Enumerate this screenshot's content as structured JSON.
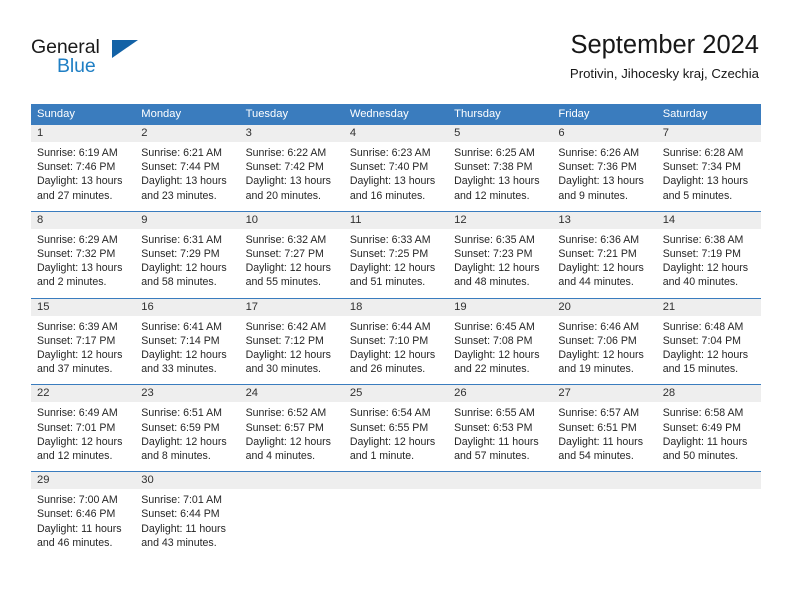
{
  "brand": {
    "name_part1": "General",
    "name_part2": "Blue",
    "accent_color": "#1f7fc4",
    "triangle_color": "#1362a6"
  },
  "header": {
    "title": "September 2024",
    "subtitle": "Protivin, Jihocesky kraj, Czechia"
  },
  "calendar": {
    "header_bg": "#3a7cbe",
    "daynum_bg": "#eeeeee",
    "weekdays": [
      "Sunday",
      "Monday",
      "Tuesday",
      "Wednesday",
      "Thursday",
      "Friday",
      "Saturday"
    ],
    "weeks": [
      [
        {
          "day": "1",
          "sunrise": "Sunrise: 6:19 AM",
          "sunset": "Sunset: 7:46 PM",
          "daylight_line1": "Daylight: 13 hours",
          "daylight_line2": "and 27 minutes."
        },
        {
          "day": "2",
          "sunrise": "Sunrise: 6:21 AM",
          "sunset": "Sunset: 7:44 PM",
          "daylight_line1": "Daylight: 13 hours",
          "daylight_line2": "and 23 minutes."
        },
        {
          "day": "3",
          "sunrise": "Sunrise: 6:22 AM",
          "sunset": "Sunset: 7:42 PM",
          "daylight_line1": "Daylight: 13 hours",
          "daylight_line2": "and 20 minutes."
        },
        {
          "day": "4",
          "sunrise": "Sunrise: 6:23 AM",
          "sunset": "Sunset: 7:40 PM",
          "daylight_line1": "Daylight: 13 hours",
          "daylight_line2": "and 16 minutes."
        },
        {
          "day": "5",
          "sunrise": "Sunrise: 6:25 AM",
          "sunset": "Sunset: 7:38 PM",
          "daylight_line1": "Daylight: 13 hours",
          "daylight_line2": "and 12 minutes."
        },
        {
          "day": "6",
          "sunrise": "Sunrise: 6:26 AM",
          "sunset": "Sunset: 7:36 PM",
          "daylight_line1": "Daylight: 13 hours",
          "daylight_line2": "and 9 minutes."
        },
        {
          "day": "7",
          "sunrise": "Sunrise: 6:28 AM",
          "sunset": "Sunset: 7:34 PM",
          "daylight_line1": "Daylight: 13 hours",
          "daylight_line2": "and 5 minutes."
        }
      ],
      [
        {
          "day": "8",
          "sunrise": "Sunrise: 6:29 AM",
          "sunset": "Sunset: 7:32 PM",
          "daylight_line1": "Daylight: 13 hours",
          "daylight_line2": "and 2 minutes."
        },
        {
          "day": "9",
          "sunrise": "Sunrise: 6:31 AM",
          "sunset": "Sunset: 7:29 PM",
          "daylight_line1": "Daylight: 12 hours",
          "daylight_line2": "and 58 minutes."
        },
        {
          "day": "10",
          "sunrise": "Sunrise: 6:32 AM",
          "sunset": "Sunset: 7:27 PM",
          "daylight_line1": "Daylight: 12 hours",
          "daylight_line2": "and 55 minutes."
        },
        {
          "day": "11",
          "sunrise": "Sunrise: 6:33 AM",
          "sunset": "Sunset: 7:25 PM",
          "daylight_line1": "Daylight: 12 hours",
          "daylight_line2": "and 51 minutes."
        },
        {
          "day": "12",
          "sunrise": "Sunrise: 6:35 AM",
          "sunset": "Sunset: 7:23 PM",
          "daylight_line1": "Daylight: 12 hours",
          "daylight_line2": "and 48 minutes."
        },
        {
          "day": "13",
          "sunrise": "Sunrise: 6:36 AM",
          "sunset": "Sunset: 7:21 PM",
          "daylight_line1": "Daylight: 12 hours",
          "daylight_line2": "and 44 minutes."
        },
        {
          "day": "14",
          "sunrise": "Sunrise: 6:38 AM",
          "sunset": "Sunset: 7:19 PM",
          "daylight_line1": "Daylight: 12 hours",
          "daylight_line2": "and 40 minutes."
        }
      ],
      [
        {
          "day": "15",
          "sunrise": "Sunrise: 6:39 AM",
          "sunset": "Sunset: 7:17 PM",
          "daylight_line1": "Daylight: 12 hours",
          "daylight_line2": "and 37 minutes."
        },
        {
          "day": "16",
          "sunrise": "Sunrise: 6:41 AM",
          "sunset": "Sunset: 7:14 PM",
          "daylight_line1": "Daylight: 12 hours",
          "daylight_line2": "and 33 minutes."
        },
        {
          "day": "17",
          "sunrise": "Sunrise: 6:42 AM",
          "sunset": "Sunset: 7:12 PM",
          "daylight_line1": "Daylight: 12 hours",
          "daylight_line2": "and 30 minutes."
        },
        {
          "day": "18",
          "sunrise": "Sunrise: 6:44 AM",
          "sunset": "Sunset: 7:10 PM",
          "daylight_line1": "Daylight: 12 hours",
          "daylight_line2": "and 26 minutes."
        },
        {
          "day": "19",
          "sunrise": "Sunrise: 6:45 AM",
          "sunset": "Sunset: 7:08 PM",
          "daylight_line1": "Daylight: 12 hours",
          "daylight_line2": "and 22 minutes."
        },
        {
          "day": "20",
          "sunrise": "Sunrise: 6:46 AM",
          "sunset": "Sunset: 7:06 PM",
          "daylight_line1": "Daylight: 12 hours",
          "daylight_line2": "and 19 minutes."
        },
        {
          "day": "21",
          "sunrise": "Sunrise: 6:48 AM",
          "sunset": "Sunset: 7:04 PM",
          "daylight_line1": "Daylight: 12 hours",
          "daylight_line2": "and 15 minutes."
        }
      ],
      [
        {
          "day": "22",
          "sunrise": "Sunrise: 6:49 AM",
          "sunset": "Sunset: 7:01 PM",
          "daylight_line1": "Daylight: 12 hours",
          "daylight_line2": "and 12 minutes."
        },
        {
          "day": "23",
          "sunrise": "Sunrise: 6:51 AM",
          "sunset": "Sunset: 6:59 PM",
          "daylight_line1": "Daylight: 12 hours",
          "daylight_line2": "and 8 minutes."
        },
        {
          "day": "24",
          "sunrise": "Sunrise: 6:52 AM",
          "sunset": "Sunset: 6:57 PM",
          "daylight_line1": "Daylight: 12 hours",
          "daylight_line2": "and 4 minutes."
        },
        {
          "day": "25",
          "sunrise": "Sunrise: 6:54 AM",
          "sunset": "Sunset: 6:55 PM",
          "daylight_line1": "Daylight: 12 hours",
          "daylight_line2": "and 1 minute."
        },
        {
          "day": "26",
          "sunrise": "Sunrise: 6:55 AM",
          "sunset": "Sunset: 6:53 PM",
          "daylight_line1": "Daylight: 11 hours",
          "daylight_line2": "and 57 minutes."
        },
        {
          "day": "27",
          "sunrise": "Sunrise: 6:57 AM",
          "sunset": "Sunset: 6:51 PM",
          "daylight_line1": "Daylight: 11 hours",
          "daylight_line2": "and 54 minutes."
        },
        {
          "day": "28",
          "sunrise": "Sunrise: 6:58 AM",
          "sunset": "Sunset: 6:49 PM",
          "daylight_line1": "Daylight: 11 hours",
          "daylight_line2": "and 50 minutes."
        }
      ],
      [
        {
          "day": "29",
          "sunrise": "Sunrise: 7:00 AM",
          "sunset": "Sunset: 6:46 PM",
          "daylight_line1": "Daylight: 11 hours",
          "daylight_line2": "and 46 minutes."
        },
        {
          "day": "30",
          "sunrise": "Sunrise: 7:01 AM",
          "sunset": "Sunset: 6:44 PM",
          "daylight_line1": "Daylight: 11 hours",
          "daylight_line2": "and 43 minutes."
        },
        {
          "day": "",
          "sunrise": "",
          "sunset": "",
          "daylight_line1": "",
          "daylight_line2": ""
        },
        {
          "day": "",
          "sunrise": "",
          "sunset": "",
          "daylight_line1": "",
          "daylight_line2": ""
        },
        {
          "day": "",
          "sunrise": "",
          "sunset": "",
          "daylight_line1": "",
          "daylight_line2": ""
        },
        {
          "day": "",
          "sunrise": "",
          "sunset": "",
          "daylight_line1": "",
          "daylight_line2": ""
        },
        {
          "day": "",
          "sunrise": "",
          "sunset": "",
          "daylight_line1": "",
          "daylight_line2": ""
        }
      ]
    ]
  }
}
